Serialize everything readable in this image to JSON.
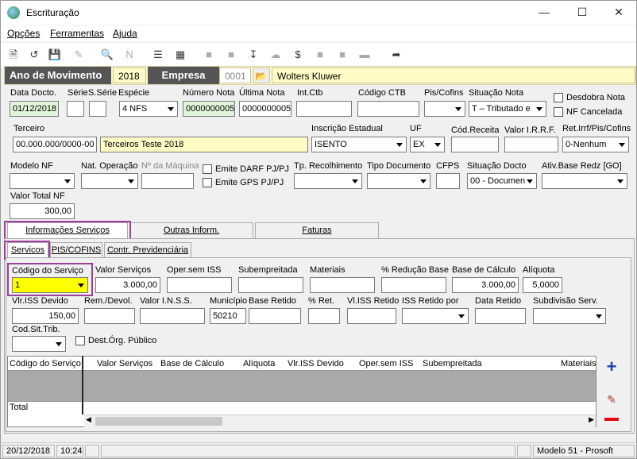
{
  "window": {
    "title": "Escrituração"
  },
  "menu": [
    "Opções",
    "Ferramentas",
    "Ajuda"
  ],
  "header": {
    "ano_label": "Ano de Movimento",
    "ano_value": "2018",
    "empresa_label": "Empresa",
    "empresa_code": "0001",
    "empresa_name": "Wolters Kluwer"
  },
  "row1": {
    "data_docto_label": "Data Docto.",
    "data_docto": "01/12/2018",
    "serie_label": "Série",
    "sserie_label": "S.Série",
    "especie_label": "Espécie",
    "especie": "4 NFS",
    "numero_label": "Número Nota",
    "numero": "0000000005",
    "ultima_label": "Última Nota",
    "ultima": "0000000005",
    "intctb_label": "Int.Ctb",
    "codctb_label": "Código CTB",
    "piscofins_label": "Pis/Cofins",
    "situacao_label": "Situação Nota",
    "situacao": "T – Tributado e",
    "desdobra_label": "Desdobra Nota",
    "cancelada_label": "NF Cancelada"
  },
  "row2": {
    "terceiro_label": "Terceiro",
    "terceiro_doc": "00.000.000/0000-00",
    "terceiro_nome": "Terceiros Teste 2018",
    "ie_label": "Inscrição Estadual",
    "ie": "ISENTO",
    "uf_label": "UF",
    "uf": "EX",
    "codreceita_label": "Cód.Receita",
    "irrf_label": "Valor I.R.R.F.",
    "retirrf_label": "Ret.Irrf/Pis/Cofins",
    "retirrf": "0-Nenhum"
  },
  "row3": {
    "modelo_label": "Modelo NF",
    "natop_label": "Nat. Operação",
    "maquina_label": "Nº da Máquina",
    "darf_label": "Emite DARF PJ/PJ",
    "gps_label": "Emite GPS PJ/PJ",
    "tprec_label": "Tp. Recolhimento",
    "tpdoc_label": "Tipo Documento",
    "cfps_label": "CFPS",
    "sitdocto_label": "Situação Docto",
    "sitdocto": "00 - Documen",
    "ativbase_label": "Ativ.Base Redz [GO]"
  },
  "total_nf": {
    "label": "Valor Total NF",
    "value": "300,00"
  },
  "tabs": [
    "Informações Serviços",
    "Outras Inform.",
    "Faturas"
  ],
  "subtabs": [
    "Servicos",
    "PIS/COFINS",
    "Contr. Previdenciária"
  ],
  "servicos": {
    "codigo_label": "Código do Serviço",
    "codigo": "1",
    "valor_label": "Valor Serviços",
    "valor": "3.000,00",
    "operiss_label": "Oper.sem ISS",
    "subemp_label": "Subempreitada",
    "materiais_label": "Materiais",
    "reducao_label": "% Redução Base",
    "basecalc_label": "Base de Cálculo",
    "basecalc": "3.000,00",
    "aliquota_label": "Alíquota",
    "aliquota": "5,0000",
    "vlriss_label": "Vlr.ISS Devido",
    "vlriss": "150,00",
    "remdevol_label": "Rem./Devol.",
    "inss_label": "Valor I.N.S.S.",
    "municipio_label": "Município",
    "municipio": "50210",
    "baseretido_label": "Base Retido",
    "pret_label": "% Ret.",
    "vlissret_label": "Vl.ISS Retido",
    "issretpor_label": "ISS Retido por",
    "dataretido_label": "Data Retido",
    "subdiv_label": "Subdivisão Serv.",
    "codsit_label": "Cod.Sit.Trib.",
    "destorg_label": "Dest.Órg. Público"
  },
  "grid": {
    "columns": [
      "Código do Serviço",
      "Valor Serviços",
      "Base de Cálculo",
      "Alíquota",
      "Vlr.ISS Devido",
      "Oper.sem ISS",
      "Subempreitada",
      "Materiais"
    ],
    "total_label": "Total"
  },
  "status": {
    "date": "20/12/2018",
    "time": "10:24",
    "model": "Modelo 51 - Prosoft"
  }
}
